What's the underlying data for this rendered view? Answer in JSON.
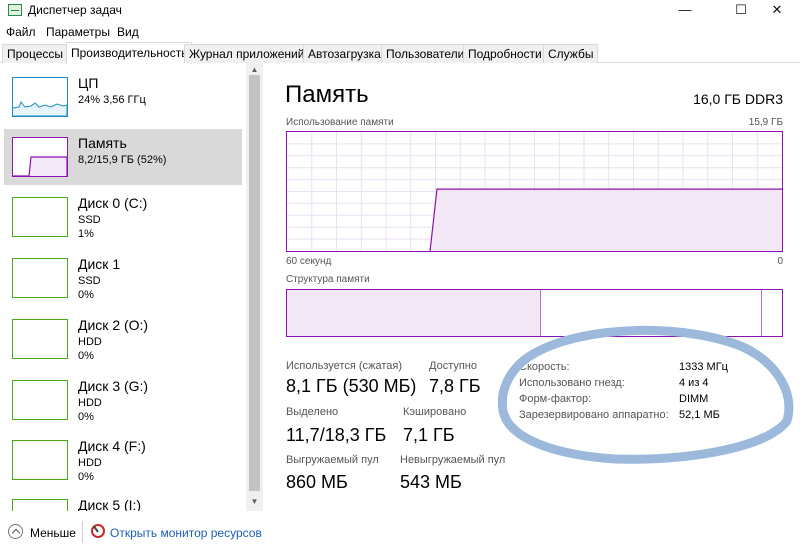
{
  "window": {
    "title": "Диспетчер задач",
    "minimize": "—",
    "maximize": "☐",
    "close": "✕"
  },
  "menu": [
    "Файл",
    "Параметры",
    "Вид"
  ],
  "tabs": [
    "Процессы",
    "Производительность",
    "Журнал приложений",
    "Автозагрузка",
    "Пользователи",
    "Подробности",
    "Службы"
  ],
  "active_tab": "Производительность",
  "sidebar": {
    "items": [
      {
        "name": "ЦП",
        "sub1": "24% 3,56 ГГц",
        "sub2": "",
        "color": "#1e8cc0"
      },
      {
        "name": "Память",
        "sub1": "8,2/15,9 ГБ (52%)",
        "sub2": "",
        "color": "#8b12ae"
      },
      {
        "name": "Диск 0 (C:)",
        "sub1": "SSD",
        "sub2": "1%",
        "color": "#4da81f"
      },
      {
        "name": "Диск 1",
        "sub1": "SSD",
        "sub2": "0%",
        "color": "#4da81f"
      },
      {
        "name": "Диск 2 (O:)",
        "sub1": "HDD",
        "sub2": "0%",
        "color": "#4da81f"
      },
      {
        "name": "Диск 3 (G:)",
        "sub1": "HDD",
        "sub2": "0%",
        "color": "#4da81f"
      },
      {
        "name": "Диск 4 (F:)",
        "sub1": "HDD",
        "sub2": "0%",
        "color": "#4da81f"
      },
      {
        "name": "Диск 5 (I:)",
        "sub1": "",
        "sub2": "",
        "color": "#4da81f"
      }
    ]
  },
  "memory": {
    "title": "Память",
    "spec": "16,0 ГБ DDR3",
    "usage_label": "Использование памяти",
    "usage_max": "15,9 ГБ",
    "time_label": "60 секунд",
    "time_zero": "0",
    "structure_label": "Структура памяти",
    "accent": "#8b12ae",
    "usage_fraction": 0.52,
    "stats": {
      "in_use_label": "Используется (сжатая)",
      "in_use_value": "8,1 ГБ (530 МБ)",
      "available_label": "Доступно",
      "available_value": "7,8 ГБ",
      "committed_label": "Выделено",
      "committed_value": "11,7/18,3 ГБ",
      "cached_label": "Кэшировано",
      "cached_value": "7,1 ГБ",
      "paged_label": "Выгружаемый пул",
      "paged_value": "860 МБ",
      "nonpaged_label": "Невыгружаемый пул",
      "nonpaged_value": "543 МБ"
    },
    "details": {
      "speed_label": "Скорость:",
      "speed_value": "1333 МГц",
      "slots_label": "Использовано гнезд:",
      "slots_value": "4 из 4",
      "form_label": "Форм-фактор:",
      "form_value": "DIMM",
      "reserved_label": "Зарезервировано аппаратно:",
      "reserved_value": "52,1 МБ"
    }
  },
  "footer": {
    "fewer": "Меньше",
    "monitor": "Открыть монитор ресурсов"
  }
}
